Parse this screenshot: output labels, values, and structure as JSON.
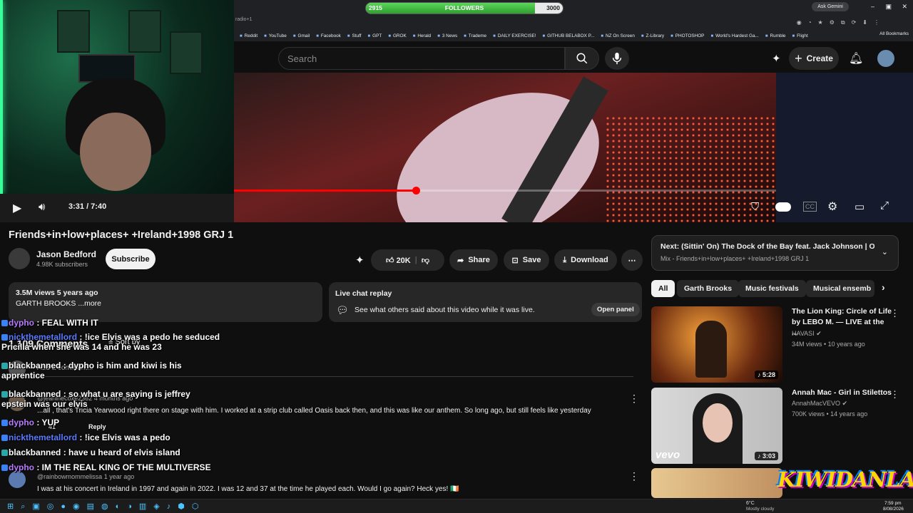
{
  "overlay": {
    "followers_label": "FOLLOWERS",
    "followers_min": "2915",
    "followers_max": "3000",
    "followers_progress": 0.86
  },
  "browser": {
    "tab_text": "radio+1",
    "gemini": "Ask Gemini",
    "all_bookmarks": "All Bookmarks",
    "bookmarks": [
      "Reddit",
      "YouTube",
      "Gmail",
      "Facebook",
      "Stuff",
      "GPT",
      "GROK",
      "Herald",
      "3 News",
      "Trademe",
      "DAILY EXERCISE!",
      "GITHUB BELABOX P...",
      "NZ On Screen",
      "Z-Library",
      "PHOTOSHOP",
      "World's Hardest Ga...",
      "Rumble",
      "Flight"
    ]
  },
  "header": {
    "search_placeholder": "Search",
    "create_label": "Create"
  },
  "player": {
    "time": "3:31 / 7:40",
    "progress": 0.335
  },
  "video": {
    "title": "Friends+in+low+places+ +Ireland+1998 GRJ 1",
    "channel": "Jason Bedford",
    "subscribers": "4.98K subscribers",
    "subscribe": "Subscribe",
    "likes": "20K",
    "share": "Share",
    "save": "Save",
    "download": "Download"
  },
  "description": {
    "views": "3.5M views  5 years ago",
    "text": "GARTH BROOKS ...more"
  },
  "live": {
    "title": "Live chat replay",
    "text": "See what others said about this video while it was live.",
    "button": "Open panel"
  },
  "comments": {
    "count": "1,109 Comments",
    "sort": "Sort by",
    "add_placeholder": "Add a comment...",
    "items": [
      {
        "author": "@jeaninecoxe2362",
        "time": "4 months ago",
        "text": "...all , that's Tricia Yearwood right there on stage with him. I worked at a strip club called Oasis back then, and this was like our anthem. So long ago, but still feels like yesterday",
        "likes": "41",
        "reply": "Reply"
      },
      {
        "author": "@rainbowmommelissa",
        "time": "1 year ago",
        "text": "I was at his concert in Ireland in 1997 and again in 2022. I was 12 and 37 at the time he played each. Would I go again? Heck yes! 🇮🇪"
      }
    ]
  },
  "chat": [
    {
      "user": "dypho",
      "color": "#b97cff",
      "msg": ": FEAL WITH IT"
    },
    {
      "user": "nickthemetallord",
      "color": "#5b7bff",
      "msg": ": !ice Elvis was a pedo he seduced Pricilla when she was 14 and he was 23"
    },
    {
      "user": "blackbanned",
      "color": "#ffffff",
      "msg": ": dypho is him and kiwi is his apprentice"
    },
    {
      "user": "blackbanned",
      "color": "#ffffff",
      "msg": ": so what u are saying is jeffrey epstein was our elvis"
    },
    {
      "user": "dypho",
      "color": "#b97cff",
      "msg": ": YUP"
    },
    {
      "user": "nickthemetallord",
      "color": "#5b7bff",
      "msg": ": !ice Elvis was a pedo"
    },
    {
      "user": "blackbanned",
      "color": "#ffffff",
      "msg": ": have u heard of elvis island"
    },
    {
      "user": "dypho",
      "color": "#b97cff",
      "msg": ": IM THE REAL KING OF THE MULTIVERSE"
    }
  ],
  "upnext": {
    "title": "Next: (Sittin' On) The Dock of the Bay feat. Jack Johnson | Oti...",
    "sub": "Mix - Friends+in+low+places+ +Ireland+1998 GRJ 1"
  },
  "chips": [
    "All",
    "Garth Brooks",
    "Music festivals",
    "Musical ensemb"
  ],
  "related": [
    {
      "title": "The Lion King: Circle of Life by LEBO M. — LIVE at the ...",
      "channel": "HAVASI",
      "meta": "34M views • 10 years ago",
      "duration": "5:28"
    },
    {
      "title": "Annah Mac - Girl in Stilettos",
      "channel": "AnnahMacVEVO",
      "meta": "700K views • 14 years ago",
      "duration": "3:03",
      "brand": "vevo"
    }
  ],
  "logo": "KIWIDANLA",
  "taskbar": {
    "weather_temp": "6°C",
    "weather_text": "Mostly cloudy",
    "time": "7:59 pm",
    "date": "8/08/2026"
  }
}
